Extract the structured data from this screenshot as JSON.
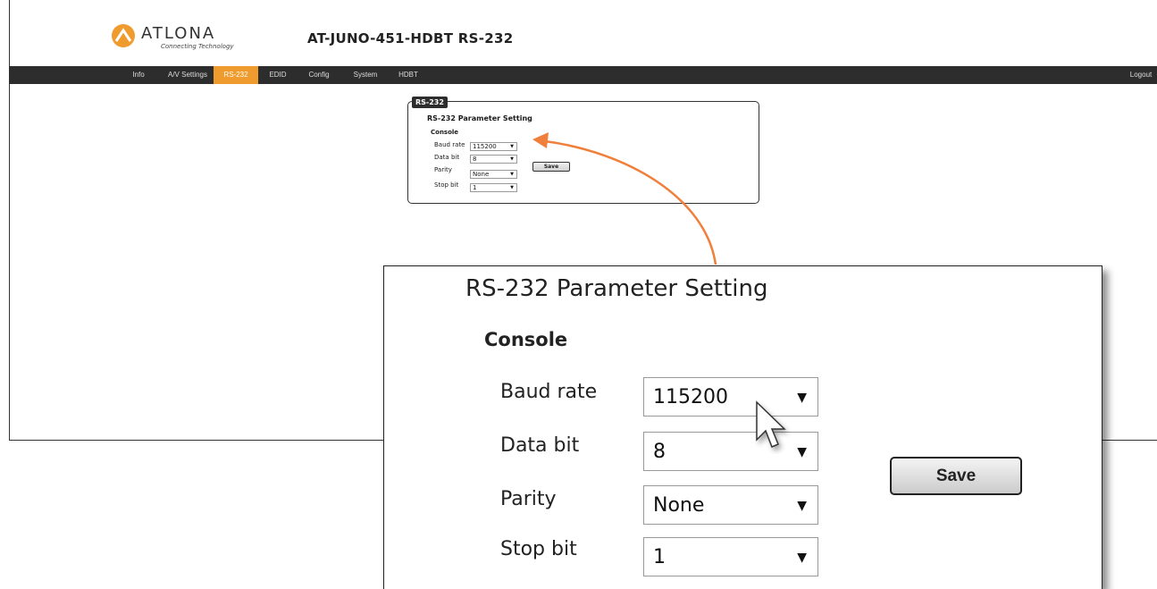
{
  "header": {
    "logo_text": "ATLONA",
    "logo_tagline": "Connecting Technology",
    "device_title": "AT-JUNO-451-HDBT  RS-232",
    "brand_color": "#ef9b2d"
  },
  "nav": {
    "items": [
      {
        "label": "Info",
        "active": false
      },
      {
        "label": "A/V Settings",
        "active": false
      },
      {
        "label": "RS-232",
        "active": true
      },
      {
        "label": "EDID",
        "active": false
      },
      {
        "label": "Config",
        "active": false
      },
      {
        "label": "System",
        "active": false
      },
      {
        "label": "HDBT",
        "active": false
      }
    ],
    "logout": "Logout"
  },
  "panel": {
    "tab": "RS-232",
    "heading": "RS-232 Parameter Setting",
    "section": "Console",
    "fields": [
      {
        "label": "Baud rate",
        "value": "115200"
      },
      {
        "label": "Data bit",
        "value": "8"
      },
      {
        "label": "Parity",
        "value": "None"
      },
      {
        "label": "Stop bit",
        "value": "1"
      }
    ],
    "save": "Save"
  },
  "zoom": {
    "heading": "RS-232 Parameter Setting",
    "section": "Console",
    "fields": [
      {
        "label": "Baud rate",
        "value": "115200"
      },
      {
        "label": "Data bit",
        "value": "8"
      },
      {
        "label": "Parity",
        "value": "None"
      },
      {
        "label": "Stop bit",
        "value": "1"
      }
    ],
    "save": "Save",
    "dropdown_arrow": "▼"
  },
  "callout_color": "#f07f3c"
}
